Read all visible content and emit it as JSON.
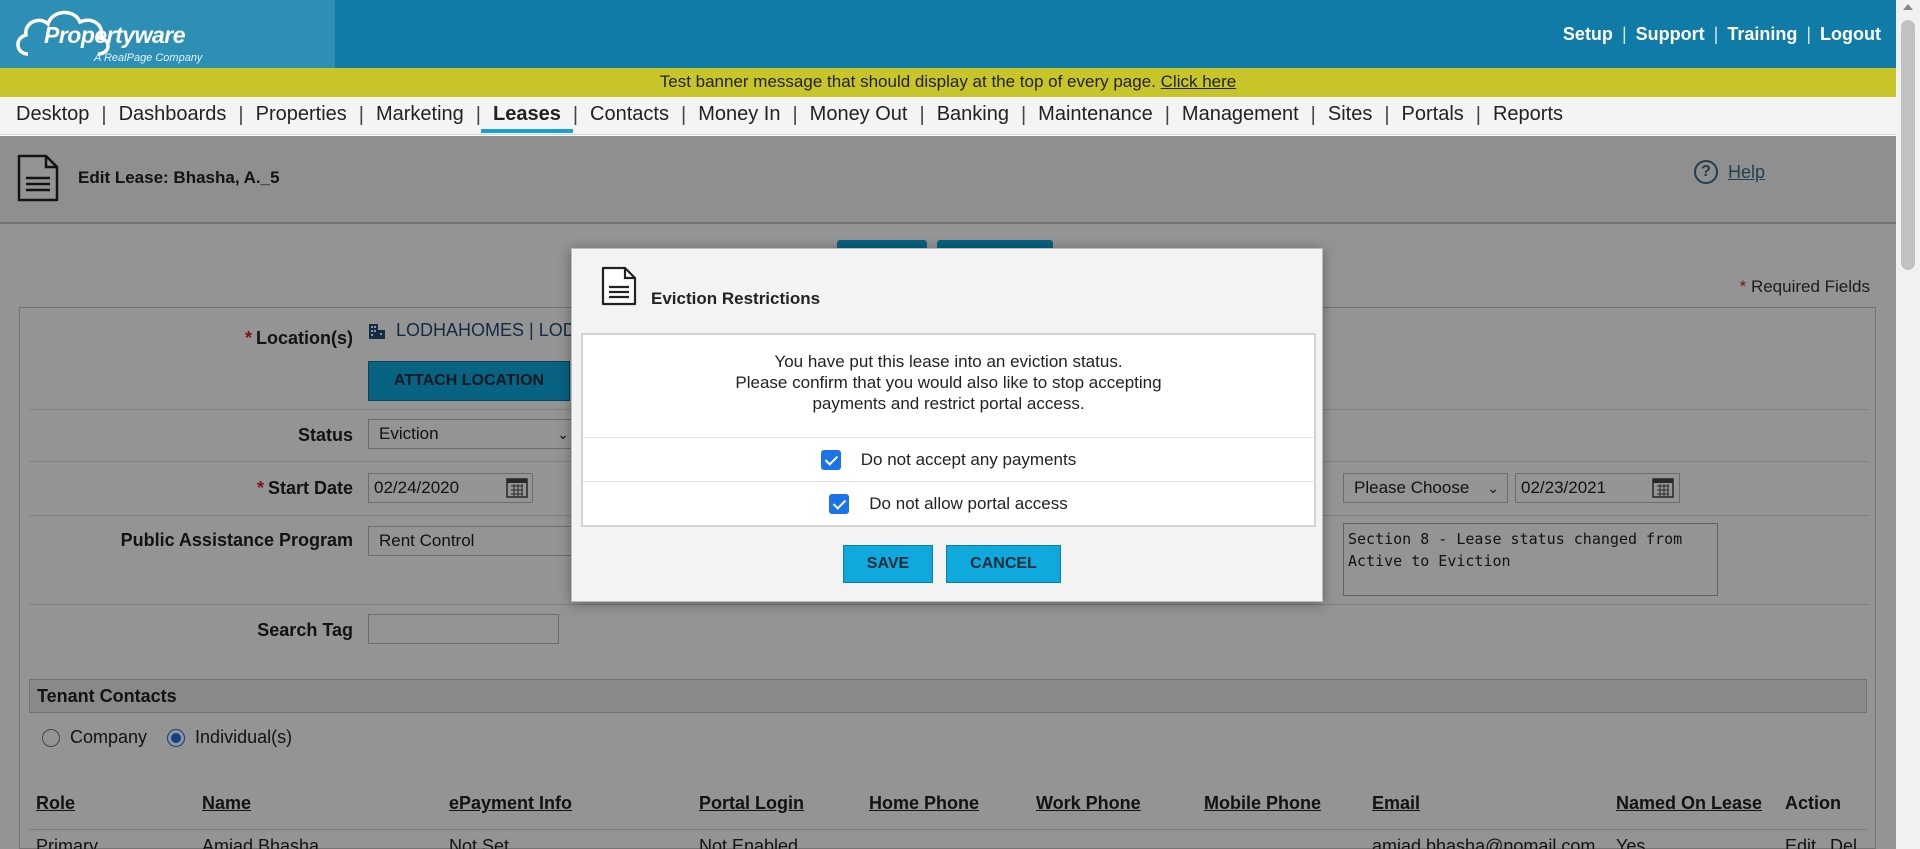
{
  "header": {
    "logo": {
      "name": "Propertyware",
      "tagline": "A RealPage Company"
    },
    "links": [
      "Setup",
      "Support",
      "Training",
      "Logout"
    ]
  },
  "banner": {
    "message": "Test banner message that should display at the top of every page.",
    "link": "Click here"
  },
  "nav": {
    "items": [
      "Desktop",
      "Dashboards",
      "Properties",
      "Marketing",
      "Leases",
      "Contacts",
      "Money In",
      "Money Out",
      "Banking",
      "Maintenance",
      "Management",
      "Sites",
      "Portals",
      "Reports"
    ],
    "active": "Leases"
  },
  "page": {
    "title": "Edit Lease: Bhasha, A._5",
    "help": "Help",
    "required_note": "Required Fields",
    "required_star": "*"
  },
  "form": {
    "location": {
      "label": "Location(s)",
      "value": "LODHAHOMES | LOD",
      "attach_button": "ATTACH LOCATION"
    },
    "status": {
      "label": "Status",
      "value": "Eviction"
    },
    "start_date": {
      "label": "Start Date",
      "value": "02/24/2020"
    },
    "end_date": {
      "term_select": "Please Choose",
      "value": "02/23/2021"
    },
    "public_assistance": {
      "label": "Public Assistance Program",
      "value": "Rent Control"
    },
    "comments": {
      "value": "Section 8 - Lease status changed from Active to Eviction"
    },
    "search_tag": {
      "label": "Search Tag",
      "value": ""
    }
  },
  "tenant_contacts": {
    "heading": "Tenant Contacts",
    "options": [
      {
        "label": "Company",
        "selected": false
      },
      {
        "label": "Individual(s)",
        "selected": true
      }
    ],
    "columns": [
      "Role",
      "Name",
      "ePayment Info",
      "Portal Login",
      "Home Phone",
      "Work Phone",
      "Mobile Phone",
      "Email",
      "Named On Lease",
      "Action"
    ],
    "rows": [
      {
        "role": "Primary",
        "name": "Amjad Bhasha",
        "epayment": "Not Set",
        "portal": "Not Enabled",
        "home": "",
        "work": "",
        "mobile": "",
        "email": "amjad.bhasha@nomail.com",
        "named": "Yes",
        "action_edit": "Edit",
        "action_del": "Del"
      }
    ]
  },
  "modal": {
    "title": "Eviction Restrictions",
    "message_lines": [
      "You have put this lease into an eviction status.",
      "Please confirm that you would also like to stop accepting",
      "payments and restrict portal access."
    ],
    "options": [
      {
        "label": "Do not accept any payments",
        "checked": true
      },
      {
        "label": "Do not allow portal access",
        "checked": true
      }
    ],
    "save": "SAVE",
    "cancel": "CANCEL"
  },
  "colors": {
    "header": "#0f7ba6",
    "banner": "#c8c52a",
    "accent": "#0fa9de",
    "checkbox": "#1a73e8"
  }
}
